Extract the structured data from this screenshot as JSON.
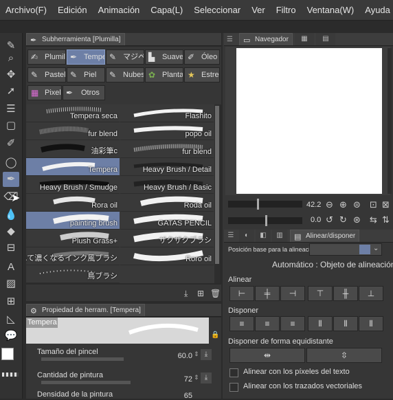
{
  "menu": [
    "Archivo(F)",
    "Edición",
    "Animación",
    "Capa(L)",
    "Seleccionar",
    "Ver",
    "Filtro",
    "Ventana(W)",
    "Ayuda"
  ],
  "subtool_panel": {
    "tab_label": "Subherramienta [Plumilla]",
    "groups": [
      {
        "label": "Plumilla",
        "icon": "pen-nib-icon",
        "selected": false
      },
      {
        "label": "Tempera",
        "icon": "brush-icon",
        "selected": true
      },
      {
        "label": "マジペ",
        "icon": "marker-icon",
        "selected": false
      },
      {
        "label": "Suave",
        "icon": "airbrush-icon",
        "selected": false
      },
      {
        "label": "Óleo",
        "icon": "oil-brush-icon",
        "selected": false
      },
      {
        "label": "Pastel",
        "icon": "pastel-icon",
        "selected": false
      },
      {
        "label": "Piel",
        "icon": "skin-brush-icon",
        "selected": false
      },
      {
        "label": "Nubes",
        "icon": "cloud-brush-icon",
        "selected": false
      },
      {
        "label": "Plantas",
        "icon": "plant-icon",
        "selected": false
      },
      {
        "label": "Estrellas",
        "icon": "star-icon",
        "selected": false
      },
      {
        "label": "Pixel",
        "icon": "pixel-icon",
        "selected": false
      },
      {
        "label": "Otros",
        "icon": "",
        "selected": false
      }
    ],
    "brushes_left": [
      {
        "label": "Tempera seca",
        "selected": false
      },
      {
        "label": "fur blend",
        "selected": false
      },
      {
        "label": "油彩筆c",
        "selected": false
      },
      {
        "label": "Tempera",
        "selected": true
      },
      {
        "label": "Heavy Brush / Smudge",
        "selected": false
      },
      {
        "label": "Rora oil",
        "selected": false
      },
      {
        "label": "painting brush",
        "selected": true
      },
      {
        "label": "Plush Grass+",
        "selected": false
      },
      {
        "label": "重ねて濃くなるインク風ブラシ",
        "selected": false
      },
      {
        "label": "鳥ブラシ",
        "selected": false
      }
    ],
    "brushes_right": [
      {
        "label": "Flashito",
        "selected": false
      },
      {
        "label": "popo oil",
        "selected": false
      },
      {
        "label": "fur blend",
        "selected": false
      },
      {
        "label": "Heavy Brush / Detail",
        "selected": false
      },
      {
        "label": "Heavy Brush / Basic",
        "selected": false
      },
      {
        "label": "Roda oil",
        "selected": false
      },
      {
        "label": "GATAS PENCIL",
        "selected": false
      },
      {
        "label": "ザクザクブラシ",
        "selected": false
      },
      {
        "label": "Roro oil",
        "selected": false
      }
    ]
  },
  "property_panel": {
    "tab_label": "Propiedad de herram. [Tempera]",
    "preset_name": "Tempera",
    "properties": [
      {
        "label": "Tamaño del pincel",
        "value": "60.0",
        "fill": 0.6
      },
      {
        "label": "Cantidad de pintura",
        "value": "72",
        "fill": 0.72
      },
      {
        "label": "Densidad de la pintura",
        "value": "65",
        "fill": 0.65
      }
    ]
  },
  "navigator": {
    "tab_label": "Navegador",
    "zoom": "42.2",
    "rotation": "0.0"
  },
  "align_panel": {
    "tab_label": "Alinear/disponer",
    "base_position_label": "Posición base para la alineación",
    "mode_text": "Automático : Objeto de alineación",
    "align_heading": "Alinear",
    "distribute_heading": "Disponer",
    "equidistant_heading": "Disponer de forma equidistante",
    "checkbox_pixels": "Alinear con los píxeles del texto",
    "checkbox_vectors": "Alinear con los trazados vectoriales"
  },
  "colors": {
    "accent": "#6d7fa6",
    "panel_bg": "#363636",
    "main_color": "#ffffff",
    "sub_color": "#0a0a3a"
  }
}
